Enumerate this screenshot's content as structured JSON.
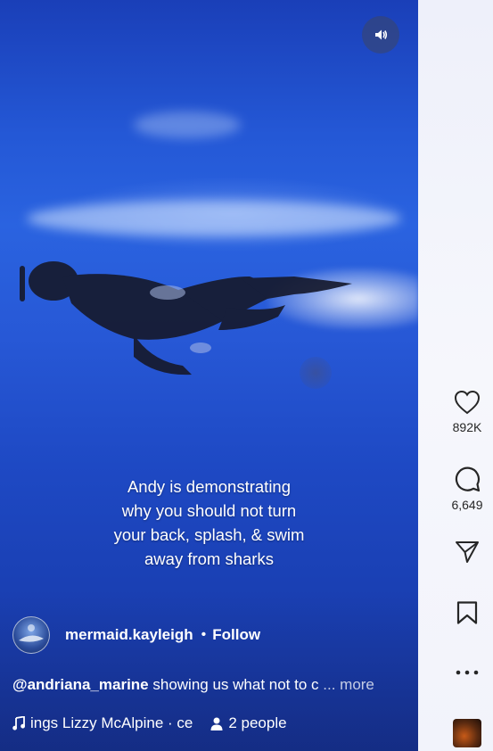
{
  "video": {
    "overlay_lines": [
      "Andy is demonstrating",
      "why you should not turn",
      "your back, splash, & swim",
      "away from sharks"
    ]
  },
  "controls": {
    "sound_icon": "speaker-icon"
  },
  "author": {
    "username": "mermaid.kayleigh",
    "separator": "•",
    "follow_label": "Follow"
  },
  "caption": {
    "mention": "@andriana_marine",
    "text": " showing us what not to c",
    "more_label": "... more"
  },
  "audio": {
    "icon": "music-note-icon",
    "track": "ings  Lizzy McAlpine · ce",
    "people_icon": "person-icon",
    "people_label": "2 people"
  },
  "actions": {
    "likes": "892K",
    "comments": "6,649"
  },
  "colors": {
    "video_blue": "#2458d6",
    "sidebar_bg": "#f2f3fb",
    "icon": "#262626"
  }
}
